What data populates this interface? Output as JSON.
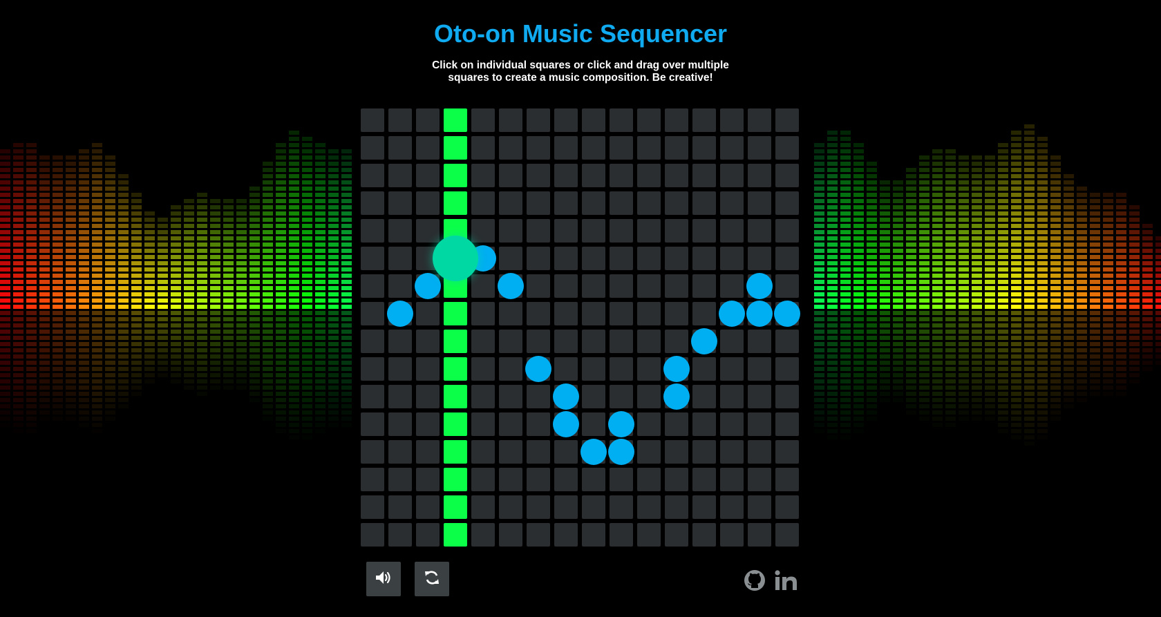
{
  "header": {
    "title": "Oto-on Music Sequencer",
    "subtitle": "Click on individual squares or click and drag over multiple squares to create a music composition. Be creative!"
  },
  "sequencer": {
    "columns": 16,
    "rows": 16,
    "playhead_column": 3,
    "active_notes": [
      {
        "col": 1,
        "row": 7
      },
      {
        "col": 2,
        "row": 6
      },
      {
        "col": 3,
        "row": 5,
        "playing": true
      },
      {
        "col": 4,
        "row": 5
      },
      {
        "col": 5,
        "row": 6
      },
      {
        "col": 6,
        "row": 9
      },
      {
        "col": 7,
        "row": 10
      },
      {
        "col": 7,
        "row": 11
      },
      {
        "col": 8,
        "row": 12
      },
      {
        "col": 9,
        "row": 11
      },
      {
        "col": 9,
        "row": 12
      },
      {
        "col": 11,
        "row": 9
      },
      {
        "col": 11,
        "row": 10
      },
      {
        "col": 12,
        "row": 8
      },
      {
        "col": 13,
        "row": 7
      },
      {
        "col": 14,
        "row": 6
      },
      {
        "col": 14,
        "row": 7
      },
      {
        "col": 15,
        "row": 7
      }
    ]
  },
  "controls": {
    "sound_icon": "volume-icon",
    "refresh_icon": "refresh-icon"
  },
  "social": {
    "github_icon": "github-icon",
    "linkedin_icon": "linkedin-icon"
  },
  "colors": {
    "title": "#10aaf0",
    "cell": "#2a2e31",
    "playhead": "#0bff49",
    "note": "#00aef2",
    "note_playing": "#00d8a4",
    "button": "#3b4043",
    "social_icon": "#8a8f92"
  }
}
